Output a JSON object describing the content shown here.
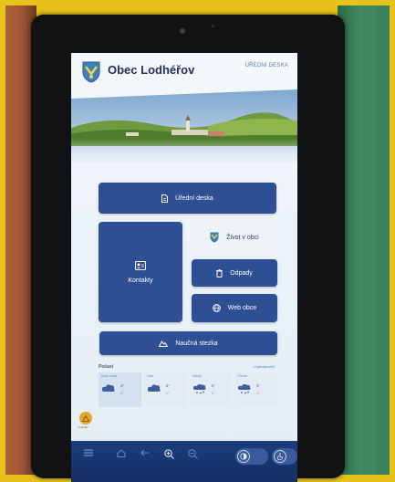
{
  "header": {
    "title": "Obec Lodhéřov",
    "official_link": "ÚŘEDNÍ DESKA"
  },
  "tiles": {
    "urad": "Úřední deska",
    "kontakty": "Kontakty",
    "zivot": "Život v obci",
    "odpady": "Odpady",
    "web": "Web obce",
    "naucna": "Naučná stezka"
  },
  "weather": {
    "title": "Počasí",
    "link": "Ú předpověď",
    "days": [
      {
        "name": "Dnes večer",
        "max": "4°",
        "min": "2°"
      },
      {
        "name": "Zítra",
        "max": "5°",
        "min": "1°"
      },
      {
        "name": "Středa",
        "max": "3°",
        "min": "1°"
      },
      {
        "name": "Čtvrtek",
        "max": "5°",
        "min": "2°"
      }
    ]
  },
  "accessibility": {
    "label": "Ovládání"
  },
  "colors": {
    "accent": "#2f4f94",
    "bar": "#1c3d7d",
    "frame": "#e7c21a"
  }
}
